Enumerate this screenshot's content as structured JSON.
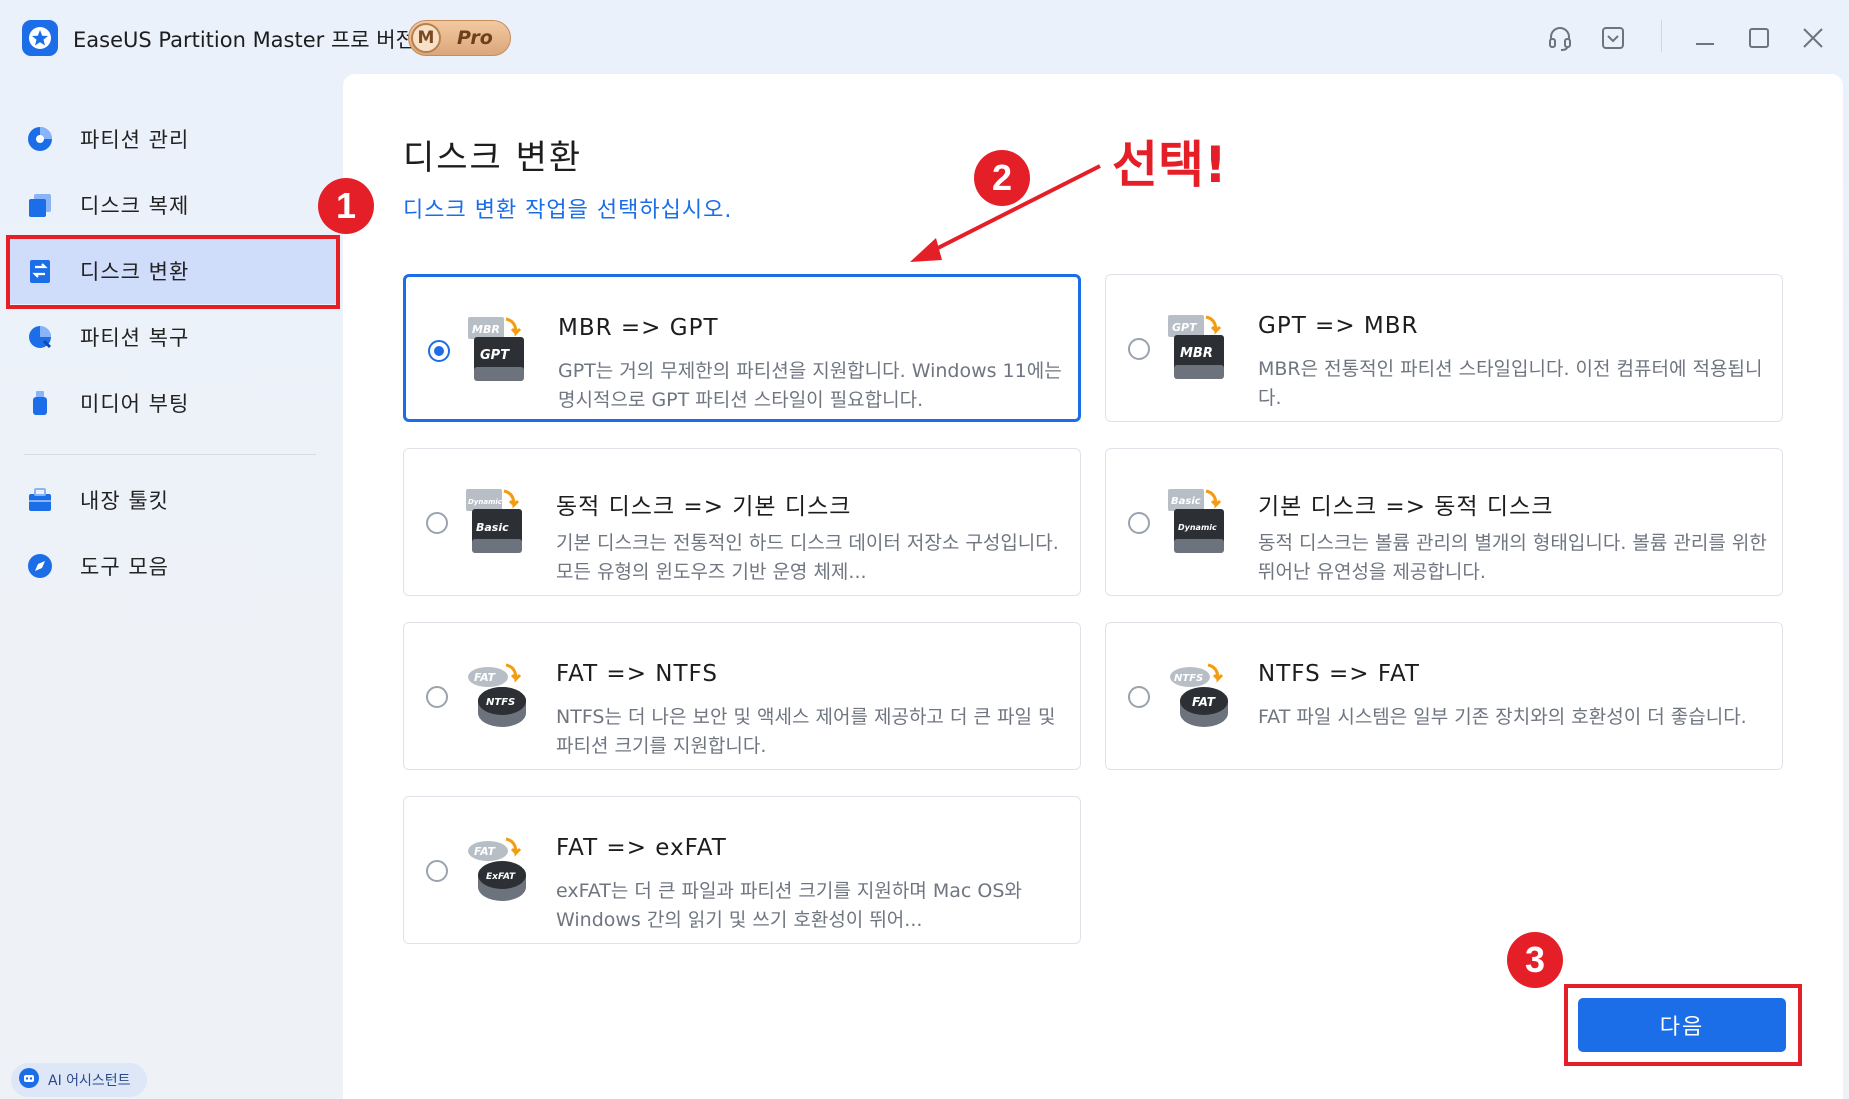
{
  "app": {
    "title": "EaseUS Partition Master 프로 버전",
    "badge_letter": "M",
    "badge_text": "Pro"
  },
  "sidebar": {
    "items": [
      {
        "label": "파티션 관리",
        "icon": "pie-chart-icon"
      },
      {
        "label": "디스크 복제",
        "icon": "disk-clone-icon"
      },
      {
        "label": "디스크 변환",
        "icon": "disk-convert-icon",
        "active": true
      },
      {
        "label": "파티션 복구",
        "icon": "partition-recovery-icon"
      },
      {
        "label": "미디어 부팅",
        "icon": "usb-drive-icon"
      },
      {
        "label": "내장 툴킷",
        "icon": "toolkit-icon"
      },
      {
        "label": "도구 모음",
        "icon": "compass-icon"
      }
    ],
    "ai_assistant": "AI 어시스턴트"
  },
  "main": {
    "title": "디스크 변환",
    "subtitle": "디스크 변환 작업을 선택하십시오.",
    "options": [
      {
        "title": "MBR => GPT",
        "desc": "GPT는 거의 무제한의 파티션을 지원합니다. Windows 11에는 명시적으로 GPT 파티션 스타일이 필요합니다.",
        "from": "MBR",
        "to": "GPT",
        "selected": true
      },
      {
        "title": "GPT => MBR",
        "desc": "MBR은 전통적인 파티션 스타일입니다. 이전 컴퓨터에 적용됩니다.",
        "from": "GPT",
        "to": "MBR",
        "selected": false
      },
      {
        "title": "동적 디스크 => 기본 디스크",
        "desc": "기본 디스크는 전통적인 하드 디스크 데이터 저장소 구성입니다. 모든 유형의 윈도우즈 기반 운영 체제...",
        "from": "Dynamic",
        "to": "Basic",
        "selected": false
      },
      {
        "title": "기본 디스크 => 동적 디스크",
        "desc": "동적 디스크는 볼륨 관리의 별개의 형태입니다. 볼륨 관리를 위한 뛰어난 유연성을 제공합니다.",
        "from": "Basic",
        "to": "Dynamic",
        "selected": false
      },
      {
        "title": "FAT => NTFS",
        "desc": "NTFS는 더 나은 보안 및 액세스 제어를 제공하고 더 큰 파일 및 파티션 크기를 지원합니다.",
        "from": "FAT",
        "to": "NTFS",
        "selected": false
      },
      {
        "title": "NTFS => FAT",
        "desc": "FAT 파일 시스템은 일부 기존 장치와의 호환성이 더 좋습니다.",
        "from": "NTFS",
        "to": "FAT",
        "selected": false
      },
      {
        "title": "FAT => exFAT",
        "desc": "exFAT는 더 큰 파일과 파티션 크기를 지원하며 Mac OS와 Windows 간의 읽기 및 쓰기 호환성이 뛰어...",
        "from": "FAT",
        "to": "ExFAT",
        "selected": false
      }
    ],
    "next_label": "다음"
  },
  "annotations": {
    "step1": "1",
    "step2": "2",
    "step3": "3",
    "select_text": "선택!"
  },
  "colors": {
    "accent": "#1b6ee8",
    "annotation": "#e51f28",
    "active_nav": "#cfdcfa"
  }
}
